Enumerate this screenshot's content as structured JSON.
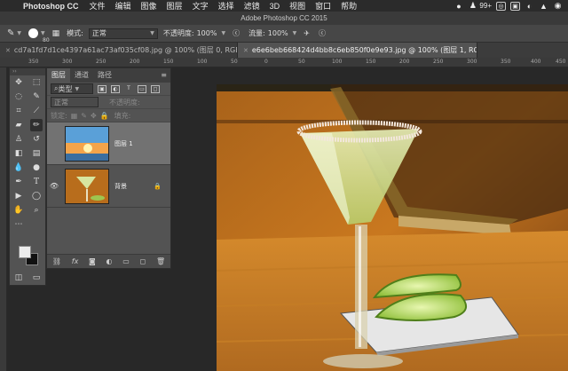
{
  "menubar": {
    "app_name": "Photoshop CC",
    "items": [
      "文件",
      "编辑",
      "图像",
      "图层",
      "文字",
      "选择",
      "滤镜",
      "3D",
      "视图",
      "窗口",
      "帮助"
    ],
    "badge": "99+"
  },
  "window": {
    "title": "Adobe Photoshop CC 2015"
  },
  "options": {
    "brush_size": "80",
    "mode_label": "模式:",
    "mode_value": "正常",
    "opacity_label": "不透明度:",
    "opacity_value": "100%",
    "flow_label": "流量:",
    "flow_value": "100%"
  },
  "tabs": [
    {
      "label": "cd7a1fd7d1ce4397a61ac73af035cf08.jpg @ 100% (图层 0, RGB/8*) *",
      "active": false
    },
    {
      "label": "e6e6beb668424d4bb8c6eb850f0e9e93.jpg @ 100% (图层 1, RGB/8*) *",
      "active": true
    }
  ],
  "ruler": {
    "ticks": [
      "350",
      "300",
      "250",
      "200",
      "150",
      "100",
      "50",
      "0",
      "50",
      "100",
      "150",
      "200",
      "250",
      "300",
      "350",
      "400",
      "450"
    ]
  },
  "layers_panel": {
    "tabs": [
      "图层",
      "通道",
      "路径"
    ],
    "filter_label": "类型",
    "blend_mode": "正常",
    "opacity_label": "不透明度:",
    "lock_label": "锁定:",
    "fill_label": "填充:",
    "layers": [
      {
        "name": "图层 1",
        "selected": true,
        "visible": false,
        "locked": false
      },
      {
        "name": "背景",
        "selected": false,
        "visible": true,
        "locked": true
      }
    ],
    "footer_icons": [
      "link-icon",
      "fx-icon",
      "mask-icon",
      "adjustment-icon",
      "group-icon",
      "new-layer-icon",
      "trash-icon"
    ]
  },
  "colors": {
    "foreground": "#ececec",
    "background": "#111111",
    "panel": "#535353"
  }
}
